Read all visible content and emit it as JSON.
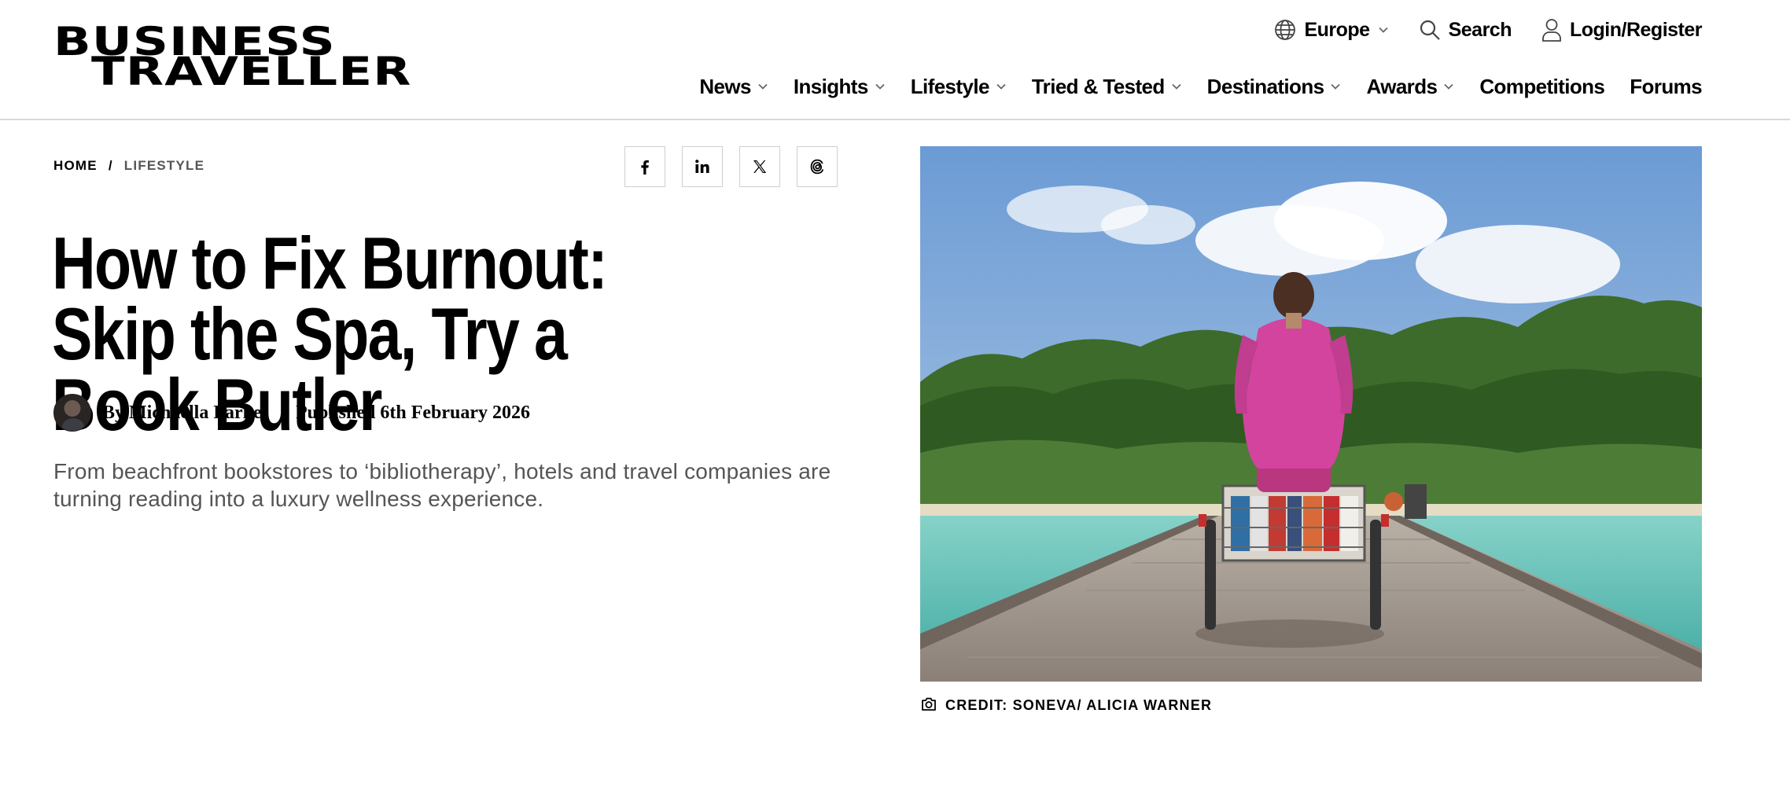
{
  "header": {
    "logo_line1": "BUSINESS",
    "logo_line2": "TRAVELLER",
    "utility": {
      "region_label": "Europe",
      "search_label": "Search",
      "login_label": "Login/Register"
    },
    "nav": [
      {
        "label": "News",
        "has_dropdown": true
      },
      {
        "label": "Insights",
        "has_dropdown": true
      },
      {
        "label": "Lifestyle",
        "has_dropdown": true
      },
      {
        "label": "Tried & Tested",
        "has_dropdown": true
      },
      {
        "label": "Destinations",
        "has_dropdown": true
      },
      {
        "label": "Awards",
        "has_dropdown": true
      },
      {
        "label": "Competitions",
        "has_dropdown": false
      },
      {
        "label": "Forums",
        "has_dropdown": false
      }
    ]
  },
  "breadcrumb": {
    "home": "HOME",
    "separator": "/",
    "current": "LIFESTYLE"
  },
  "share": {
    "icons": [
      "facebook-icon",
      "linkedin-icon",
      "x-icon",
      "threads-icon"
    ]
  },
  "article": {
    "title": "How to Fix Burnout: Skip the Spa, Try a Book Butler",
    "author": "By Michaella Parkes",
    "published": "Published 6th February 2026",
    "standfirst": "From beachfront bookstores to ‘bibliotherapy’, hotels and travel companies are turning reading into a luxury wellness experience.",
    "image_credit": "CREDIT: SONEVA/ ALICIA WARNER"
  },
  "colors": {
    "text": "#000000",
    "muted": "#555555",
    "divider": "#d9d9d9",
    "shirt_pink": "#d2449e",
    "water_teal": "#5fc6bb",
    "sky_blue": "#6f9fd6"
  }
}
